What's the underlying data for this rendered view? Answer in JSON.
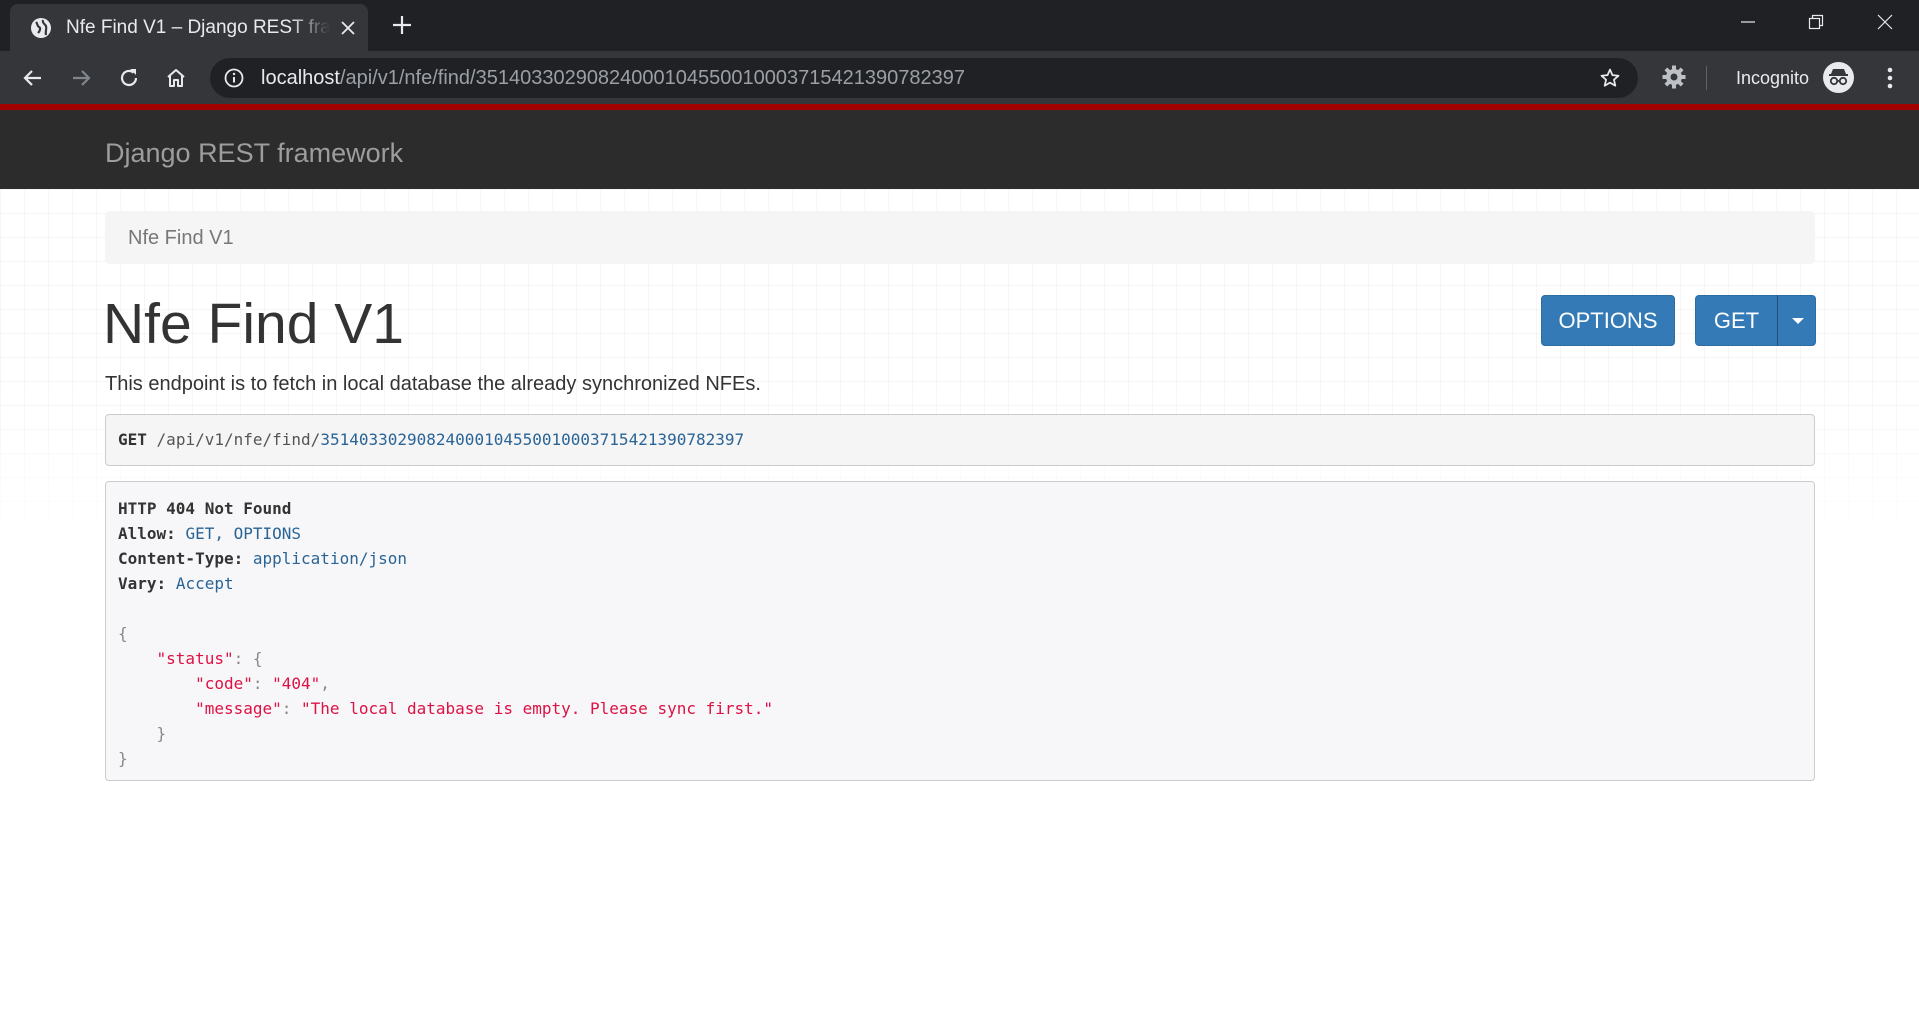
{
  "browser": {
    "tab_title": "Nfe Find V1 – Django REST framework",
    "url_host": "localhost",
    "url_path": "/api/v1/nfe/find/35140330290824000104550010003715421390782397",
    "incognito_label": "Incognito",
    "icons": [
      "globe-icon",
      "close-icon",
      "plus-icon",
      "minimize-icon",
      "restore-icon",
      "window-close-icon",
      "back-icon",
      "forward-icon",
      "reload-icon",
      "home-icon",
      "info-icon",
      "star-icon",
      "extension-gear-icon",
      "incognito-icon",
      "more-icon"
    ]
  },
  "navbar": {
    "brand": "Django REST framework",
    "accent_color": "#a30000"
  },
  "breadcrumb": {
    "item": "Nfe Find V1"
  },
  "content": {
    "title": "Nfe Find V1",
    "description": "This endpoint is to fetch in local database the already synchronized NFEs.",
    "buttons": {
      "options": "OPTIONS",
      "get": "GET"
    },
    "button_color": "#337ab7"
  },
  "request": {
    "method": "GET",
    "path_prefix": "/api/v1/nfe/find/",
    "key": "35140330290824000104550010003715421390782397"
  },
  "response": {
    "status_line": "HTTP 404 Not Found",
    "headers": [
      {
        "name": "Allow:",
        "value": "GET, OPTIONS"
      },
      {
        "name": "Content-Type:",
        "value": "application/json"
      },
      {
        "name": "Vary:",
        "value": "Accept"
      }
    ],
    "body": {
      "status_key": "\"status\"",
      "code_key": "\"code\"",
      "code_value": "\"404\"",
      "message_key": "\"message\"",
      "message_value": "\"The local database is empty. Please sync first.\""
    }
  }
}
